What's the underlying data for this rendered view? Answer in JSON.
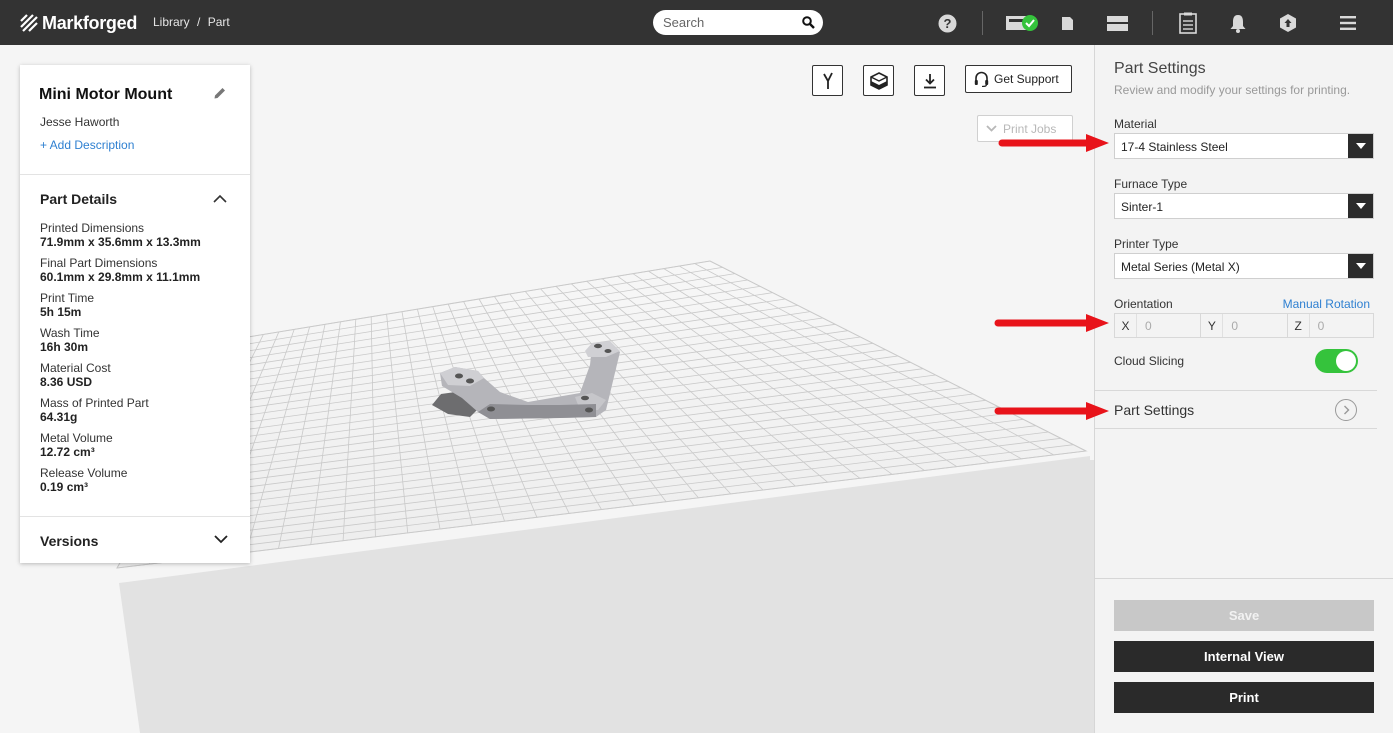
{
  "header": {
    "brand": "Markforged",
    "breadcrumb": [
      "Library",
      "Part"
    ],
    "breadcrumb_sep": "/",
    "search_placeholder": "Search",
    "icons": [
      "help-icon",
      "printer-status-icon",
      "material-icon",
      "printer-icon",
      "clipboard-icon",
      "bell-icon",
      "account-icon",
      "menu-icon"
    ]
  },
  "part": {
    "name": "Mini Motor Mount",
    "author": "Jesse Haworth",
    "add_description": "+ Add Description",
    "details_title": "Part Details",
    "details": [
      {
        "label": "Printed Dimensions",
        "value": "71.9mm x 35.6mm x 13.3mm"
      },
      {
        "label": "Final Part Dimensions",
        "value": "60.1mm x 29.8mm x 11.1mm"
      },
      {
        "label": "Print Time",
        "value": "5h 15m"
      },
      {
        "label": "Wash Time",
        "value": "16h 30m"
      },
      {
        "label": "Material Cost",
        "value": "8.36 USD"
      },
      {
        "label": "Mass of Printed Part",
        "value": "64.31g"
      },
      {
        "label": "Metal Volume",
        "value": "12.72 cm³"
      },
      {
        "label": "Release Volume",
        "value": "0.19 cm³"
      }
    ],
    "versions_title": "Versions"
  },
  "toolbar": {
    "get_support": "Get Support",
    "print_jobs": "Print Jobs"
  },
  "settings": {
    "title": "Part Settings",
    "subtitle": "Review and modify your settings for printing.",
    "material_label": "Material",
    "material_value": "17-4 Stainless Steel",
    "furnace_label": "Furnace Type",
    "furnace_value": "Sinter-1",
    "printer_label": "Printer Type",
    "printer_value": "Metal Series (Metal X)",
    "orientation_label": "Orientation",
    "manual_rotation": "Manual Rotation",
    "orientation": [
      {
        "axis": "X",
        "value": "0"
      },
      {
        "axis": "Y",
        "value": "0"
      },
      {
        "axis": "Z",
        "value": "0"
      }
    ],
    "cloud_slicing_label": "Cloud Slicing",
    "cloud_slicing_on": true,
    "part_settings_link": "Part Settings",
    "save": "Save",
    "internal_view": "Internal View",
    "print": "Print"
  },
  "colors": {
    "topbar": "#333333",
    "accent_link": "#2f80d1",
    "toggle_on": "#35c33c",
    "annotation_arrow": "#e8131a"
  }
}
